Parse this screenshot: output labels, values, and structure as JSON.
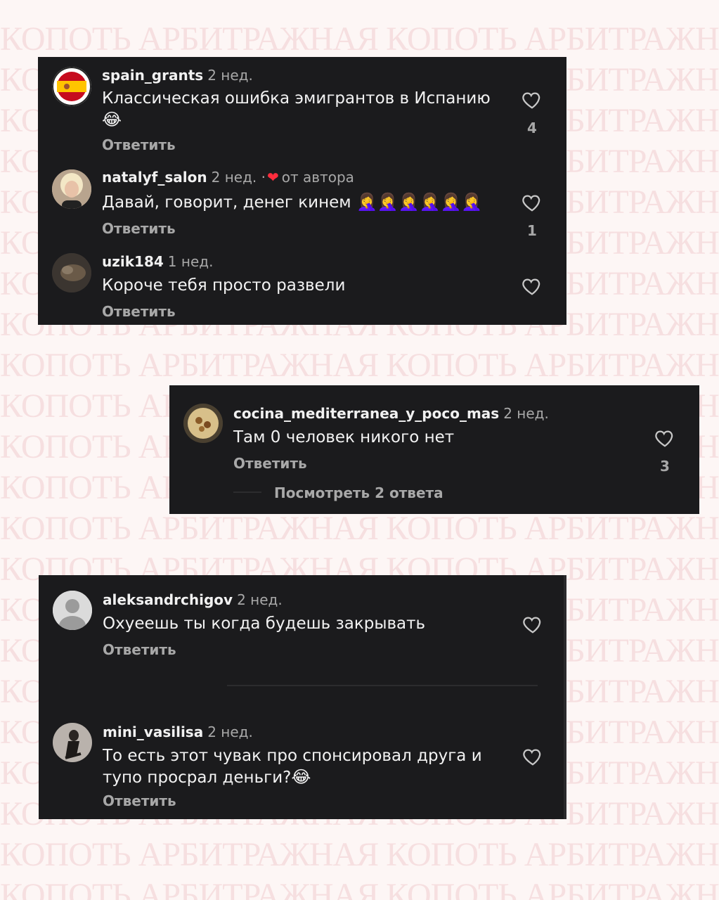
{
  "watermark": {
    "text": "КОПОТЬ АРБИТРАЖНАЯ КОПОТЬ АРБИТРАЖНАЯ"
  },
  "panels": [
    {
      "comments": [
        {
          "username": "spain_grants",
          "time": "2 нед.",
          "text": "Классическая ошибка эмигрантов в Испанию",
          "emoji_line": "😂",
          "reply": "Ответить",
          "likes": "4",
          "avatar": "spain-flag-avatar"
        },
        {
          "username": "natalyf_salon",
          "time": "2 нед.",
          "separator": "·",
          "author_like": "от автора",
          "text": "Давай, говорит, денег кинем",
          "emojis": "🤦‍♀️🤦‍♀️🤦‍♀️🤦‍♀️🤦‍♀️🤦‍♀️",
          "reply": "Ответить",
          "likes": "1",
          "avatar": "blonde-woman-avatar"
        },
        {
          "username": "uzik184",
          "time": "1 нед.",
          "text": "Короче тебя просто развели",
          "reply": "Ответить",
          "likes": "",
          "avatar": "dark-photo-avatar"
        }
      ]
    },
    {
      "comments": [
        {
          "username": "cocina_mediterranea_y_poco_mas",
          "time": "2 нед.",
          "text": "Там 0 человек никого нет",
          "reply": "Ответить",
          "likes": "3",
          "view_replies": "Посмотреть 2 ответа",
          "avatar": "food-dish-avatar"
        }
      ]
    },
    {
      "comments": [
        {
          "username": "aleksandrchigov",
          "time": "2 нед.",
          "text": "Охуеешь ты когда будешь закрывать",
          "reply": "Ответить",
          "likes": "",
          "avatar": "default-user-avatar"
        },
        {
          "username": "mini_vasilisa",
          "time": "2 нед.",
          "text_line1": "То есть этот чувак про спонсировал друга и",
          "text_line2": "тупо просрал деньги?",
          "emoji": "😂",
          "reply": "Ответить",
          "likes": "",
          "avatar": "woman-photo-avatar"
        }
      ]
    }
  ],
  "colors": {
    "panel_bg": "#1b1b1d",
    "page_bg": "#fdf6f5",
    "watermark": "#f6dfe0",
    "author_heart": "#ff2d3d"
  }
}
